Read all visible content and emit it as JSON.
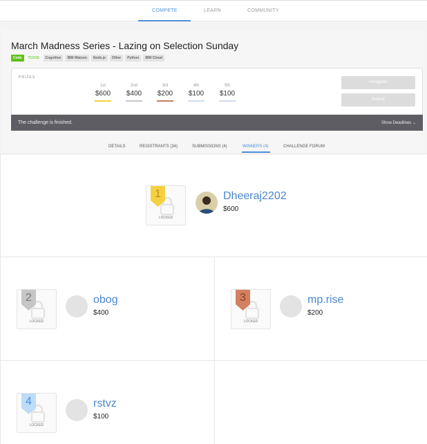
{
  "nav": {
    "tabs": [
      "COMPETE",
      "LEARN",
      "COMMUNITY"
    ]
  },
  "challenge": {
    "title": "March Madness Series - Lazing on Selection Sunday",
    "tags": [
      "Code",
      "TCO18",
      "Cognitive",
      "IBM Watson",
      "Node.js",
      "Other",
      "Python",
      "IBM Cloud"
    ]
  },
  "prizes": {
    "label": "PRIZES",
    "items": [
      {
        "place": "1st",
        "amount": "$600",
        "color": "#f5d142"
      },
      {
        "place": "2nd",
        "amount": "$400",
        "color": "#c6c6c6"
      },
      {
        "place": "3rd",
        "amount": "$200",
        "color": "#c97c5d"
      },
      {
        "place": "4th",
        "amount": "$100",
        "color": "#cfdcee"
      },
      {
        "place": "5th",
        "amount": "$100",
        "color": "#cfdcee"
      }
    ]
  },
  "buttons": {
    "unregister": "Unregister",
    "submit": "Submit"
  },
  "status": {
    "message": "The challenge is finished.",
    "show_deadlines": "Show Deadlines"
  },
  "tabs": [
    "DETAILS",
    "REGISTRANTS (34)",
    "SUBMISSIONS (4)",
    "WINNERS (4)",
    "CHALLENGE FORUM"
  ],
  "winners": [
    {
      "rank": "1",
      "name": "Dheeraj2202",
      "amount": "$600",
      "locked": "LOCKED",
      "color": "#f5d142",
      "text": "#b8921a"
    },
    {
      "rank": "2",
      "name": "obog",
      "amount": "$400",
      "locked": "LOCKED",
      "color": "#c6c6c6",
      "text": "#777"
    },
    {
      "rank": "3",
      "name": "mp.rise",
      "amount": "$200",
      "locked": "LOCKED",
      "color": "#d2805f",
      "text": "#8a3f22"
    },
    {
      "rank": "4",
      "name": "rstvz",
      "amount": "$100",
      "locked": "LOCKED",
      "color": "#bcdcf8",
      "text": "#4a90d9"
    }
  ]
}
